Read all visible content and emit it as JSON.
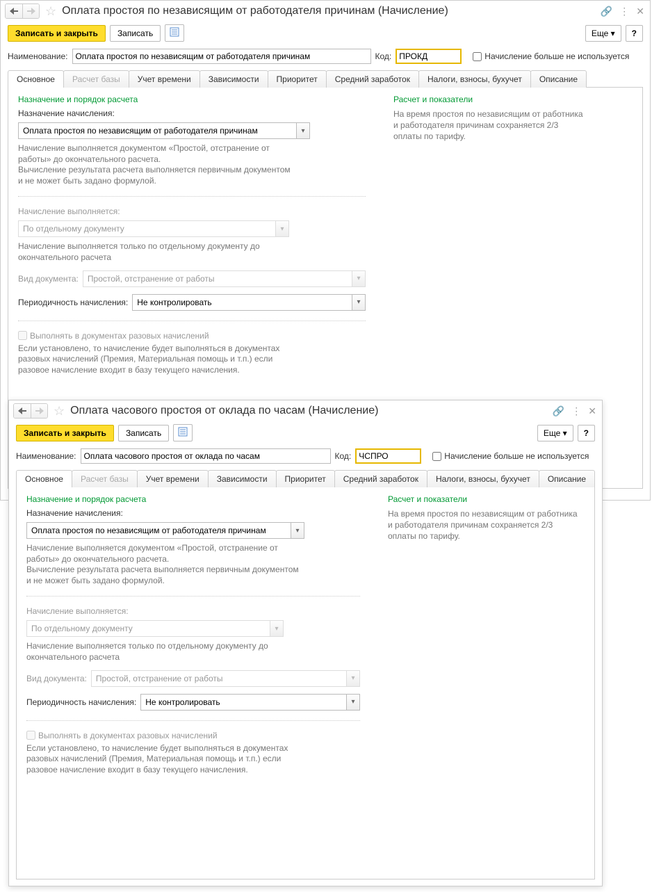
{
  "win1": {
    "title": "Оплата простоя по независящим от работодателя причинам (Начисление)",
    "save_close": "Записать и закрыть",
    "save": "Записать",
    "more": "Еще",
    "help": "?",
    "name_lbl": "Наименование:",
    "name_val": "Оплата простоя по независящим от работодателя причинам",
    "code_lbl": "Код:",
    "code_val": "ПРОКД",
    "inactive_chk": "Начисление больше не используется",
    "tabs": [
      "Основное",
      "Расчет базы",
      "Учет времени",
      "Зависимости",
      "Приоритет",
      "Средний заработок",
      "Налоги, взносы, бухучет",
      "Описание"
    ],
    "left": {
      "sec1_title": "Назначение и порядок расчета",
      "purpose_lbl": "Назначение начисления:",
      "purpose_val": "Оплата простоя по независящим от работодателя причинам",
      "purpose_help": "Начисление выполняется документом «Простой, отстранение от работы» до окончательного расчета.\nВычисление результата расчета выполняется первичным документом и не может быть задано формулой.",
      "exec_lbl": "Начисление выполняется:",
      "exec_val": "По отдельному документу",
      "exec_help": "Начисление выполняется только по отдельному документу до окончательного расчета",
      "doctype_lbl": "Вид документа:",
      "doctype_val": "Простой, отстранение от работы",
      "period_lbl": "Периодичность начисления:",
      "period_val": "Не контролировать",
      "onetime_chk": "Выполнять в документах разовых начислений",
      "onetime_help": "Если установлено, то начисление будет выполняться в документах разовых начислений (Премия, Материальная помощь и т.п.) если разовое начисление входит в базу текущего начисления."
    },
    "right": {
      "sec_title": "Расчет и показатели",
      "text": "На время простоя по независящим от работника и работодателя причинам сохраняется 2/3 оплаты по тарифу."
    }
  },
  "win2": {
    "title": "Оплата часового простоя от оклада по часам (Начисление)",
    "save_close": "Записать и закрыть",
    "save": "Записать",
    "more": "Еще",
    "help": "?",
    "name_lbl": "Наименование:",
    "name_val": "Оплата часового простоя от оклада по часам",
    "code_lbl": "Код:",
    "code_val": "ЧСПРО",
    "inactive_chk": "Начисление больше не используется",
    "tabs": [
      "Основное",
      "Расчет базы",
      "Учет времени",
      "Зависимости",
      "Приоритет",
      "Средний заработок",
      "Налоги, взносы, бухучет",
      "Описание"
    ],
    "left": {
      "sec1_title": "Назначение и порядок расчета",
      "purpose_lbl": "Назначение начисления:",
      "purpose_val": "Оплата простоя по независящим от работодателя причинам",
      "purpose_help": "Начисление выполняется документом «Простой, отстранение от работы» до окончательного расчета.\nВычисление результата расчета выполняется первичным документом и не может быть задано формулой.",
      "exec_lbl": "Начисление выполняется:",
      "exec_val": "По отдельному документу",
      "exec_help": "Начисление выполняется только по отдельному документу до окончательного расчета",
      "doctype_lbl": "Вид документа:",
      "doctype_val": "Простой, отстранение от работы",
      "period_lbl": "Периодичность начисления:",
      "period_val": "Не контролировать",
      "onetime_chk": "Выполнять в документах разовых начислений",
      "onetime_help": "Если установлено, то начисление будет выполняться в документах разовых начислений (Премия, Материальная помощь и т.п.) если разовое начисление входит в базу текущего начисления."
    },
    "right": {
      "sec_title": "Расчет и показатели",
      "text": "На время простоя по независящим от работника и работодателя причинам сохраняется 2/3 оплаты по тарифу."
    }
  }
}
